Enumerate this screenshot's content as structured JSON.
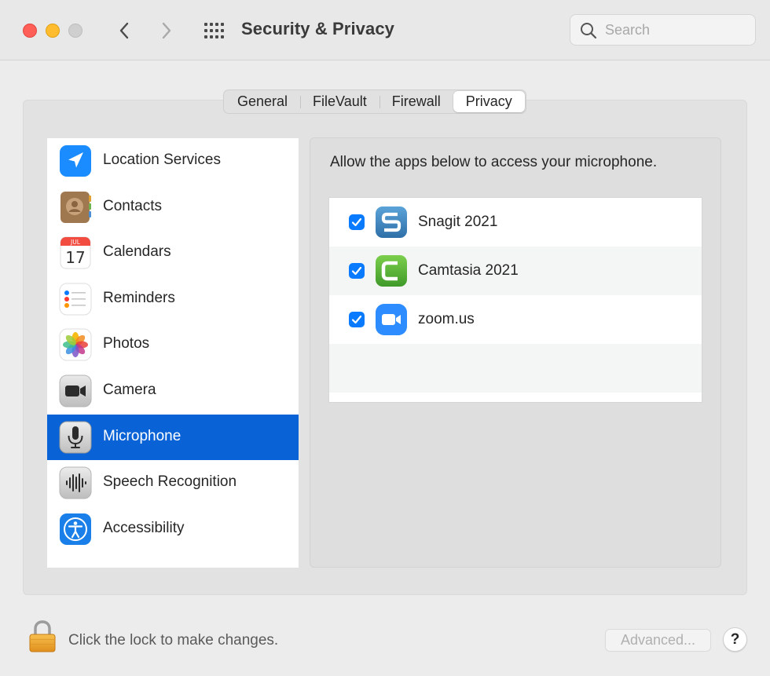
{
  "window": {
    "title": "Security & Privacy"
  },
  "search": {
    "placeholder": "Search",
    "value": ""
  },
  "tabs": [
    {
      "label": "General",
      "selected": false
    },
    {
      "label": "FileVault",
      "selected": false
    },
    {
      "label": "Firewall",
      "selected": false
    },
    {
      "label": "Privacy",
      "selected": true
    }
  ],
  "sidebar": {
    "items": [
      {
        "label": "Location Services",
        "icon": "location-arrow-icon",
        "selected": false
      },
      {
        "label": "Contacts",
        "icon": "contacts-icon",
        "selected": false
      },
      {
        "label": "Calendars",
        "icon": "calendar-icon",
        "selected": false,
        "icon_month": "JUL",
        "icon_day": "17"
      },
      {
        "label": "Reminders",
        "icon": "reminders-icon",
        "selected": false
      },
      {
        "label": "Photos",
        "icon": "photos-icon",
        "selected": false
      },
      {
        "label": "Camera",
        "icon": "camera-icon",
        "selected": false
      },
      {
        "label": "Microphone",
        "icon": "microphone-icon",
        "selected": true
      },
      {
        "label": "Speech Recognition",
        "icon": "speech-recognition-icon",
        "selected": false
      },
      {
        "label": "Accessibility",
        "icon": "accessibility-icon",
        "selected": false
      }
    ]
  },
  "privacy_panel": {
    "heading": "Allow the apps below to access your microphone.",
    "apps": [
      {
        "name": "Snagit 2021",
        "checked": true,
        "icon": "snagit-icon"
      },
      {
        "name": "Camtasia 2021",
        "checked": true,
        "icon": "camtasia-icon"
      },
      {
        "name": "zoom.us",
        "checked": true,
        "icon": "zoom-icon"
      }
    ]
  },
  "footer": {
    "lock_text": "Click the lock to make changes.",
    "advanced_label": "Advanced...",
    "help_label": "?"
  },
  "colors": {
    "selection_blue": "#0a63d6",
    "checkbox_blue": "#0a7aff",
    "close": "#ff5f57",
    "minimize": "#febc2e",
    "zoom_disabled": "#cfcfcf"
  }
}
